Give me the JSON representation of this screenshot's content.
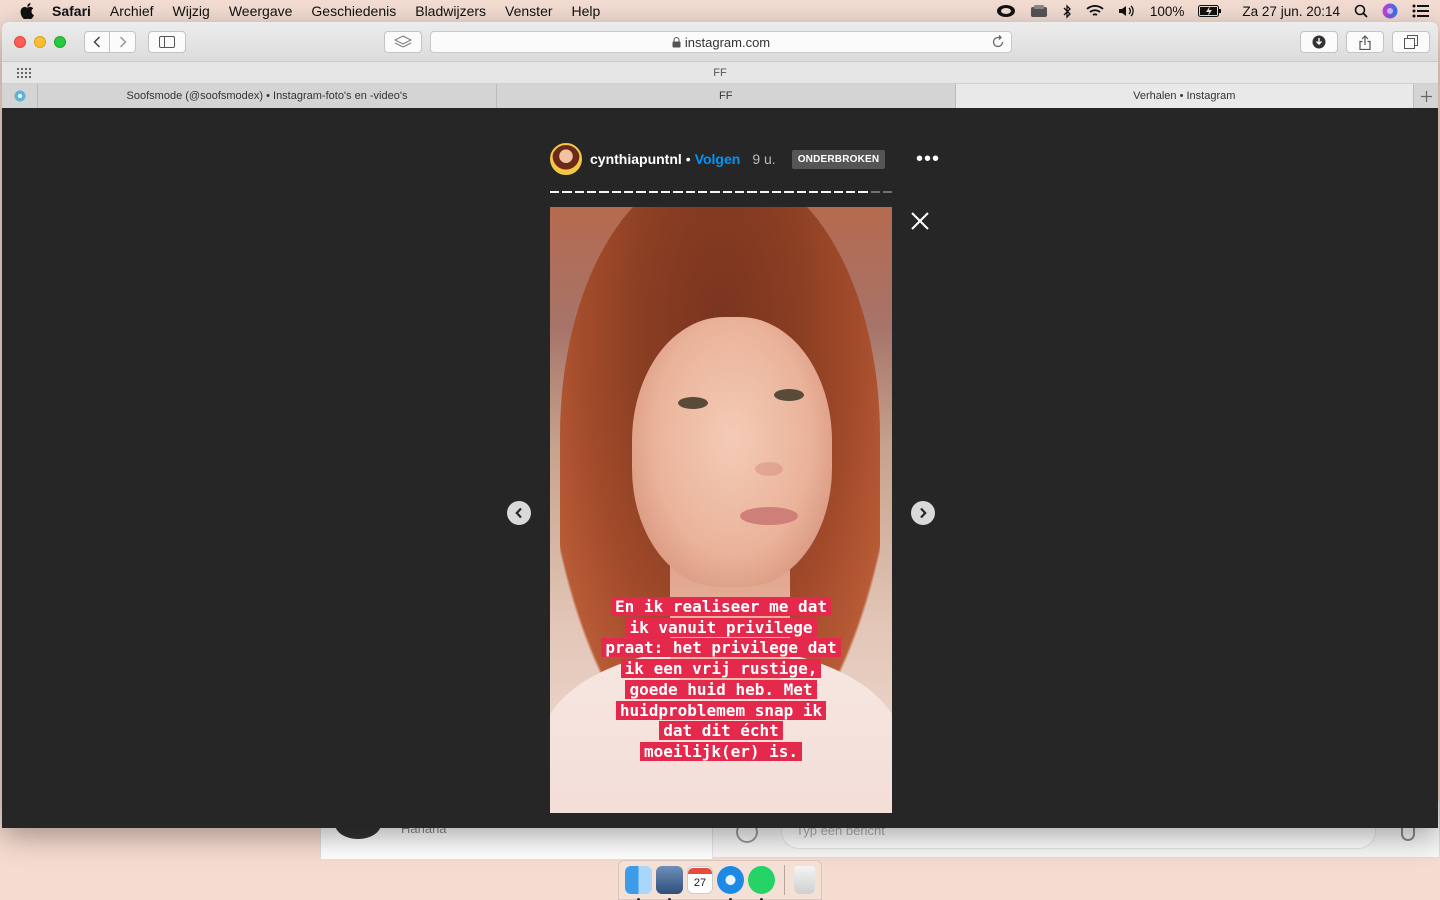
{
  "menubar": {
    "app_name": "Safari",
    "items": [
      "Archief",
      "Wijzig",
      "Weergave",
      "Geschiedenis",
      "Bladwijzers",
      "Venster",
      "Help"
    ],
    "battery": "100%",
    "datetime": "Za 27 jun.  20:14"
  },
  "toolbar": {
    "url": "instagram.com"
  },
  "favorites": {
    "title": "FF"
  },
  "tabs": [
    {
      "label": "Soofsmode (@soofsmodex) • Instagram-foto's en -video's"
    },
    {
      "label": "FF"
    },
    {
      "label": "Verhalen • Instagram"
    }
  ],
  "story": {
    "username": "cynthiapuntnl",
    "separator": "•",
    "follow_label": "Volgen",
    "time": "9 u.",
    "status_badge": "ONDERBROKEN",
    "more": "•••",
    "caption_lines": [
      "En ik realiseer me dat",
      "ik vanuit privilege",
      "praat: het privilege dat",
      "ik een vrij rustige,",
      "goede huid heb. Met",
      "huidproblemem snap ik",
      "dat dit écht",
      "moeilijk(er) is."
    ],
    "progress_total": 28,
    "progress_done": 26
  },
  "background_app": {
    "chat_name": "Hanana",
    "message_placeholder": "Typ een bericht"
  },
  "dock": {
    "calendar_day": "27"
  }
}
